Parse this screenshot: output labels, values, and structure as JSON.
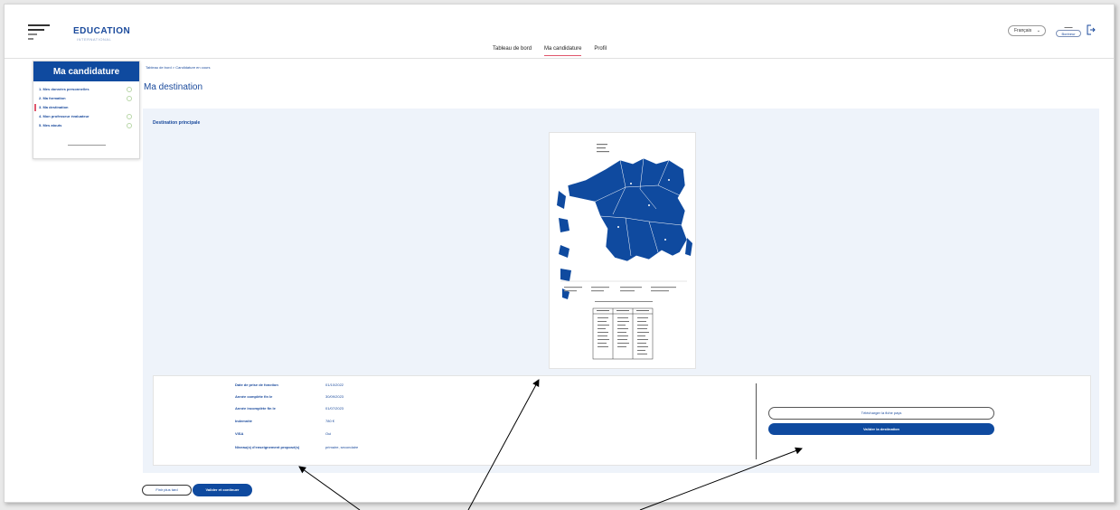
{
  "colors": {
    "brand": "#0f4a9f",
    "accent": "#e0566b",
    "panel_bg": "#eef3fa",
    "dot": "#b9d7a8"
  },
  "header": {
    "brand": "EDUCATION",
    "brand_sub": "INTERNATIONAL",
    "nav": [
      {
        "label": "Tableau de bord",
        "active": false
      },
      {
        "label": "Ma candidature",
        "active": true
      },
      {
        "label": "Profil",
        "active": false
      }
    ],
    "language": "Français",
    "user_badge": "Bonheur",
    "icons": {
      "logo": "logo-icon",
      "logout": "logout-icon",
      "chevron": "chevron-down-icon"
    }
  },
  "sidebar": {
    "title": "Ma candidature",
    "items": [
      {
        "label": "1. Mes données personnelles",
        "active": false
      },
      {
        "label": "2. Ma formation",
        "active": false
      },
      {
        "label": "3. Ma destination",
        "active": true
      },
      {
        "label": "4. Mon professeur évaluateur",
        "active": false
      },
      {
        "label": "5. Mes atouts",
        "active": false
      }
    ]
  },
  "main": {
    "breadcrumb": "Tableau de bord > Candidature en cours",
    "title": "Ma destination",
    "panel_label": "Destination principale",
    "info": [
      {
        "label": "Date de prise de fonction",
        "value": "01/10/2022"
      },
      {
        "label": "Année complète fin le",
        "value": "30/09/2023"
      },
      {
        "label": "Année incomplète fin le",
        "value": "01/07/2023"
      },
      {
        "label": "Indemnité",
        "value": "780 €"
      },
      {
        "label": "VISA",
        "value": "Oui"
      },
      {
        "label": "Niveau(x) d'enseignement proposé(s)",
        "value": "primaire, secondaire"
      }
    ],
    "download_button": "Télécharger la fiche pays",
    "validate_button": "Valider la destination"
  },
  "footer": {
    "later_button": "Finir plus tard",
    "continue_button": "Valider et continuer"
  }
}
